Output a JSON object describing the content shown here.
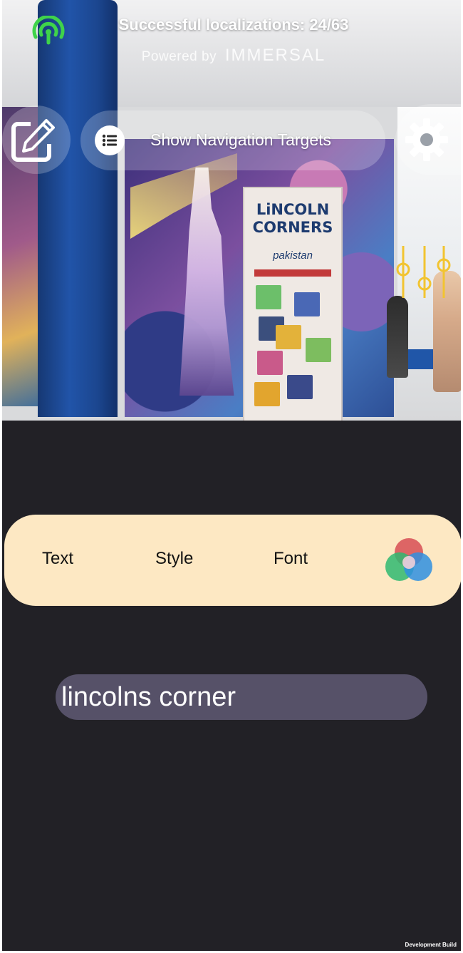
{
  "status": {
    "localizations_text": "Successful localizations: 24/63",
    "powered_by": "Powered by",
    "brand": "IMMERSAL"
  },
  "toolbar": {
    "edit_icon": "edit-icon",
    "nav_targets_label": "Show Navigation Targets",
    "list_icon": "list-icon",
    "settings_icon": "gear-icon"
  },
  "scene": {
    "banner_title": "LiNCOLN CORNERS",
    "banner_subtitle": "pakistan"
  },
  "editor": {
    "tabs": [
      "Text",
      "Style",
      "Font"
    ],
    "color_icon": "color-wheel-icon",
    "text_value": "lincolns corner"
  },
  "footer": {
    "build_label": "Development Build"
  },
  "colors": {
    "accent_green": "#3fd34a",
    "tab_bar_bg": "#fde8c3",
    "text_field_bg": "#565168",
    "panel_bg": "#222126"
  }
}
